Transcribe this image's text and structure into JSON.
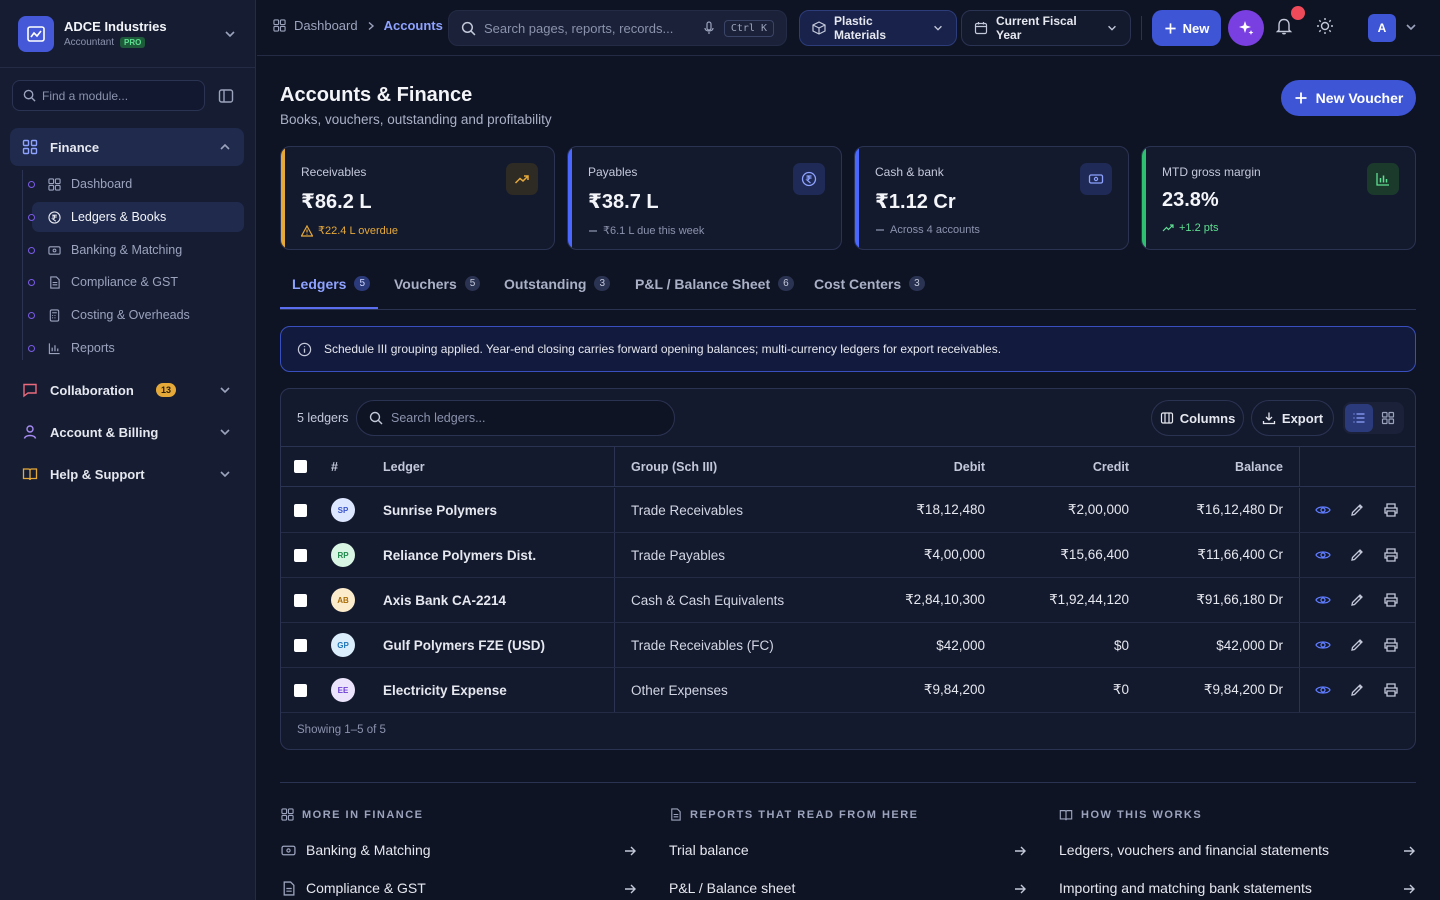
{
  "org": {
    "name": "ADCE Industries",
    "role": "Accountant",
    "plan": "PRO"
  },
  "sidebar": {
    "search_placeholder": "Find a module...",
    "groups": [
      {
        "label": "Finance",
        "icon": "grid-icon"
      },
      {
        "label": "Collaboration",
        "icon": "chat-icon",
        "badge": "13"
      },
      {
        "label": "Account & Billing",
        "icon": "user-icon"
      },
      {
        "label": "Help & Support",
        "icon": "book-icon"
      }
    ],
    "finance_items": [
      {
        "label": "Dashboard",
        "icon": "grid-icon"
      },
      {
        "label": "Ledgers & Books",
        "icon": "rupee-icon"
      },
      {
        "label": "Banking & Matching",
        "icon": "bank-card-icon"
      },
      {
        "label": "Compliance & GST",
        "icon": "document-icon"
      },
      {
        "label": "Costing & Overheads",
        "icon": "calculator-icon"
      },
      {
        "label": "Reports",
        "icon": "bar-chart-icon"
      }
    ]
  },
  "topbar": {
    "breadcrumb": [
      "Dashboard",
      "Accounts"
    ],
    "search_placeholder": "Search pages, reports, records...",
    "shortcut": "Ctrl K",
    "project": "Plastic Materials",
    "period": "Current Fiscal Year",
    "new_label": "New",
    "avatar_initial": "A"
  },
  "page": {
    "title": "Accounts & Finance",
    "subtitle": "Books, vouchers, outstanding and profitability",
    "new_voucher": "New Voucher"
  },
  "kpis": [
    {
      "label": "Receivables",
      "value": "₹86.2 L",
      "note": "₹22.4 L overdue",
      "color": "#e5a93a",
      "note_color": "#e5a93a",
      "icon": "trend-up-icon"
    },
    {
      "label": "Payables",
      "value": "₹38.7 L",
      "note": "₹6.1 L due this week",
      "color": "#4a67ff",
      "note_color": "#8b93ad",
      "icon": "rupee-icon"
    },
    {
      "label": "Cash & bank",
      "value": "₹1.12 Cr",
      "note": "Across 4 accounts",
      "color": "#4a67ff",
      "note_color": "#8b93ad",
      "icon": "cash-icon"
    },
    {
      "label": "MTD gross margin",
      "value": "23.8%",
      "note": "+1.2 pts",
      "color": "#2fbf71",
      "note_color": "#5fdf91",
      "icon": "bar-chart-icon"
    }
  ],
  "tabs": [
    {
      "label": "Ledgers",
      "count": "5"
    },
    {
      "label": "Vouchers",
      "count": "5"
    },
    {
      "label": "Outstanding",
      "count": "3"
    },
    {
      "label": "P&L / Balance Sheet",
      "count": "6"
    },
    {
      "label": "Cost Centers",
      "count": "3"
    }
  ],
  "info": "Schedule III grouping applied. Year-end closing carries forward opening balances; multi-currency ledgers for export receivables.",
  "table": {
    "count_label": "5 ledgers",
    "search_placeholder": "Search ledgers...",
    "columns_btn": "Columns",
    "export_btn": "Export",
    "headers": {
      "num": "#",
      "ledger": "Ledger",
      "group": "Group (Sch III)",
      "debit": "Debit",
      "credit": "Credit",
      "balance": "Balance"
    },
    "rows": [
      {
        "initials": "SP",
        "ledger": "Sunrise Polymers",
        "group": "Trade Receivables",
        "debit": "₹18,12,480",
        "credit": "₹2,00,000",
        "balance": "₹16,12,480 Dr",
        "av_bg": "#dde7ff",
        "av_fg": "#3a55c9"
      },
      {
        "initials": "RP",
        "ledger": "Reliance Polymers Dist.",
        "group": "Trade Payables",
        "debit": "₹4,00,000",
        "credit": "₹15,66,400",
        "balance": "₹11,66,400 Cr",
        "av_bg": "#d9f5e3",
        "av_fg": "#1f8a4c"
      },
      {
        "initials": "AB",
        "ledger": "Axis Bank CA-2214",
        "group": "Cash & Cash Equivalents",
        "debit": "₹2,84,10,300",
        "credit": "₹1,92,44,120",
        "balance": "₹91,66,180 Dr",
        "av_bg": "#fdeccc",
        "av_fg": "#a86a06"
      },
      {
        "initials": "GP",
        "ledger": "Gulf Polymers FZE (USD)",
        "group": "Trade Receivables (FC)",
        "debit": "$42,000",
        "credit": "$0",
        "balance": "$42,000 Dr",
        "av_bg": "#dbeefc",
        "av_fg": "#2176b8"
      },
      {
        "initials": "EE",
        "ledger": "Electricity Expense",
        "group": "Other Expenses",
        "debit": "₹9,84,200",
        "credit": "₹0",
        "balance": "₹9,84,200 Dr",
        "av_bg": "#ece4fd",
        "av_fg": "#6c3fd0"
      }
    ],
    "footer": "Showing 1–5 of 5"
  },
  "more": {
    "col1": {
      "title": "MORE IN FINANCE",
      "links": [
        "Banking & Matching",
        "Compliance & GST"
      ]
    },
    "col2": {
      "title": "REPORTS THAT READ FROM HERE",
      "links": [
        "Trial balance",
        "P&L / Balance sheet"
      ]
    },
    "col3": {
      "title": "HOW THIS WORKS",
      "links": [
        "Ledgers, vouchers and financial statements",
        "Importing and matching bank statements"
      ]
    }
  }
}
